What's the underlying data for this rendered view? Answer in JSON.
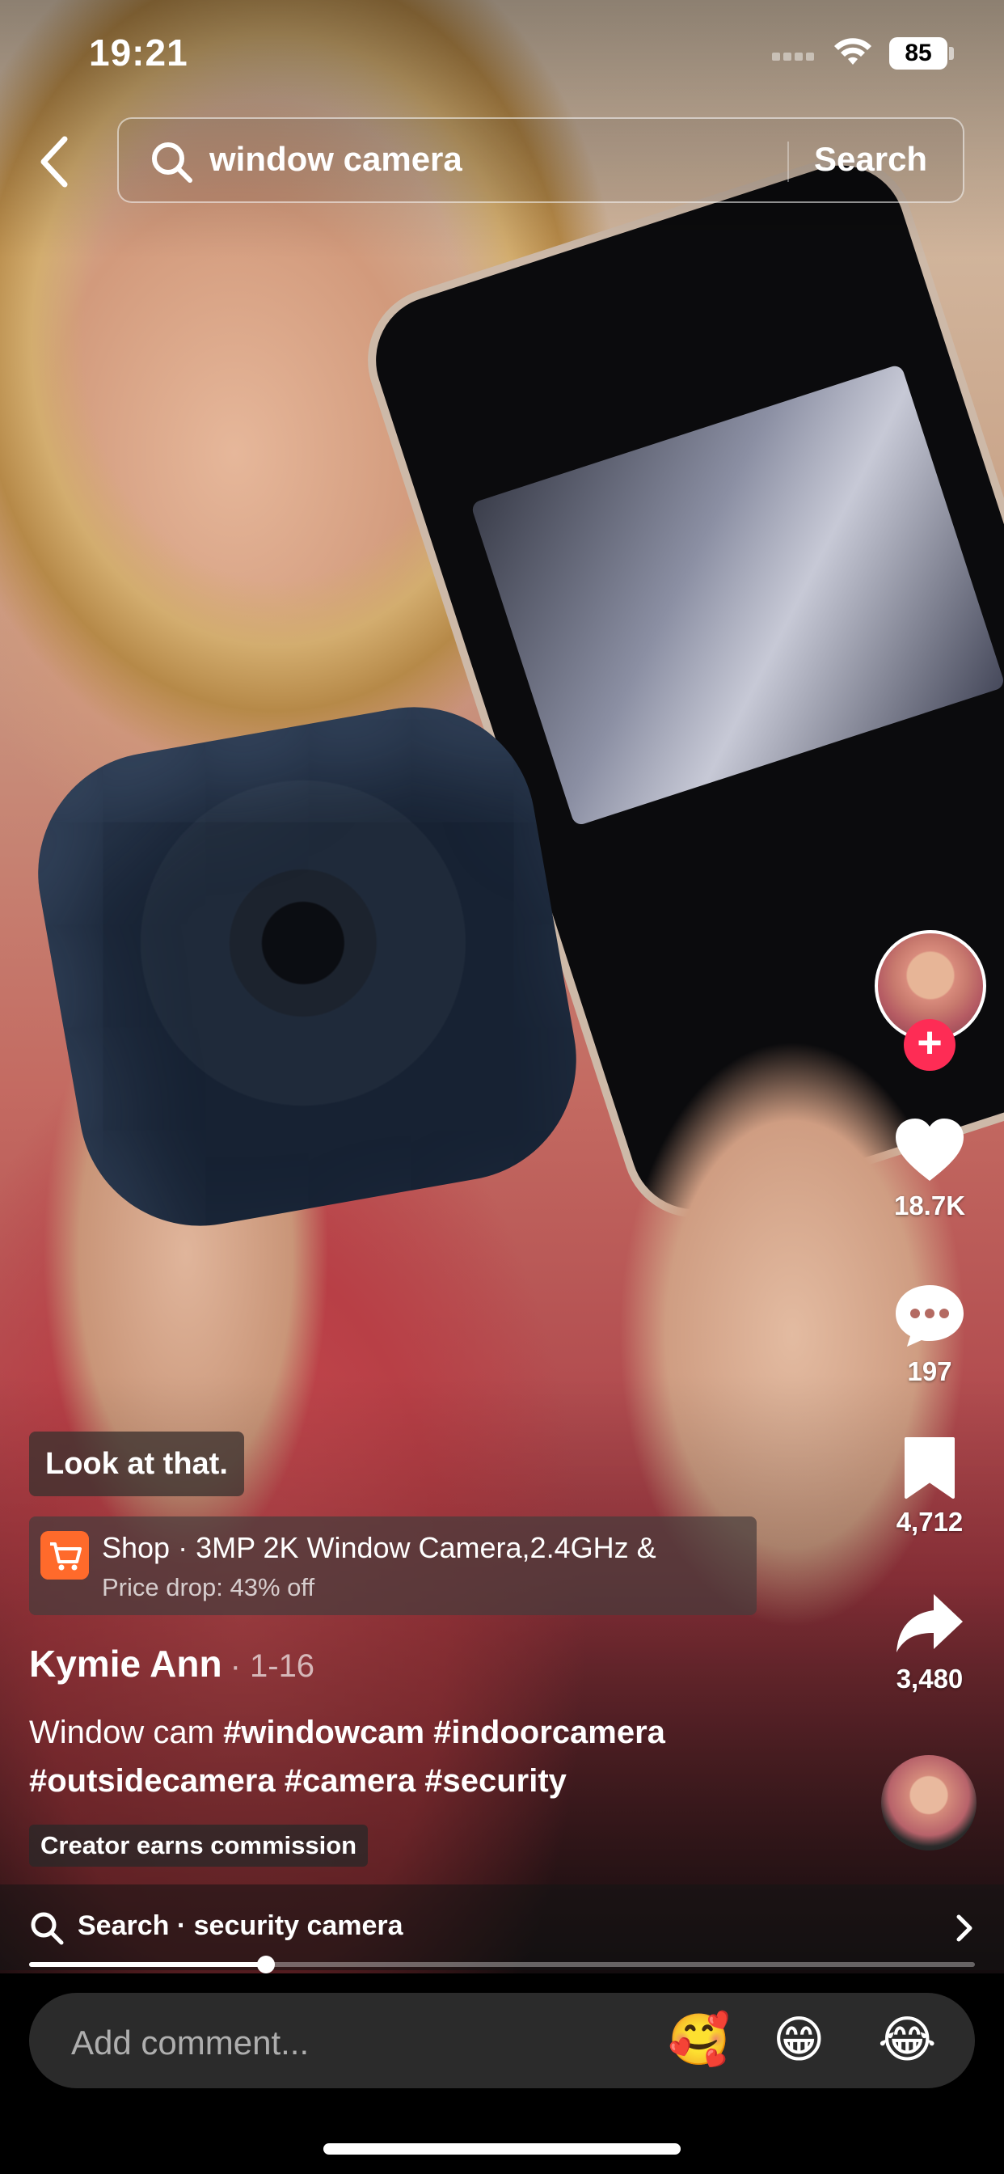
{
  "status_bar": {
    "time": "19:21",
    "battery": "85"
  },
  "search": {
    "query": "window camera",
    "button_label": "Search"
  },
  "sidebar": {
    "likes": "18.7K",
    "comments": "197",
    "saves": "4,712",
    "shares": "3,480",
    "follow_symbol": "+"
  },
  "video": {
    "sticker_text": "Look at that.",
    "shop": {
      "title": "Shop · 3MP 2K Window Camera,2.4GHz &",
      "subtitle": "Price drop: 43% off"
    },
    "author": "Kymie Ann",
    "date": "· 1-16",
    "caption_text": "Window cam ",
    "hashtags": [
      "#windowcam",
      "#indoorcamera",
      "#outsidecamera",
      "#camera",
      "#security"
    ],
    "commission_badge": "Creator earns commission",
    "progress_percent": 25
  },
  "related_search": {
    "label": "Search · security camera"
  },
  "comment_bar": {
    "placeholder": "Add comment...",
    "emojis": [
      "🥰",
      "😁",
      "😂"
    ]
  },
  "colors": {
    "accent": "#fe2c55",
    "shop": "#ff6a2b"
  }
}
